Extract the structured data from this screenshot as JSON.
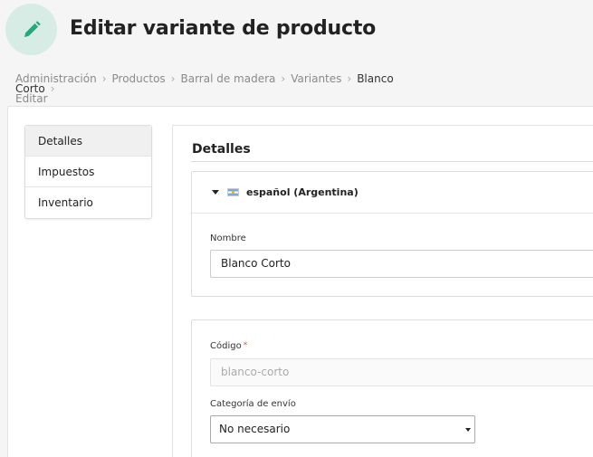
{
  "header": {
    "title": "Editar variante de producto",
    "icon": "pencil-icon",
    "accent_color": "#d8ece6",
    "icon_color": "#2aa67d"
  },
  "breadcrumb": {
    "items": [
      "Administración",
      "Productos",
      "Barral de madera",
      "Variantes",
      "Blanco Corto"
    ],
    "last": "Editar"
  },
  "sidemenu": {
    "items": [
      "Detalles",
      "Impuestos",
      "Inventario"
    ],
    "active": "Detalles"
  },
  "details": {
    "title": "Detalles",
    "translation": {
      "language": "español (Argentina)",
      "flag_icon": "argentina-flag-icon",
      "name_label": "Nombre",
      "name_value": "Blanco Corto"
    },
    "code_label": "Código",
    "code_required_mark": "*",
    "code_value": "blanco-corto",
    "shipping_label": "Categoría de envío",
    "shipping_value": "No necesario"
  }
}
